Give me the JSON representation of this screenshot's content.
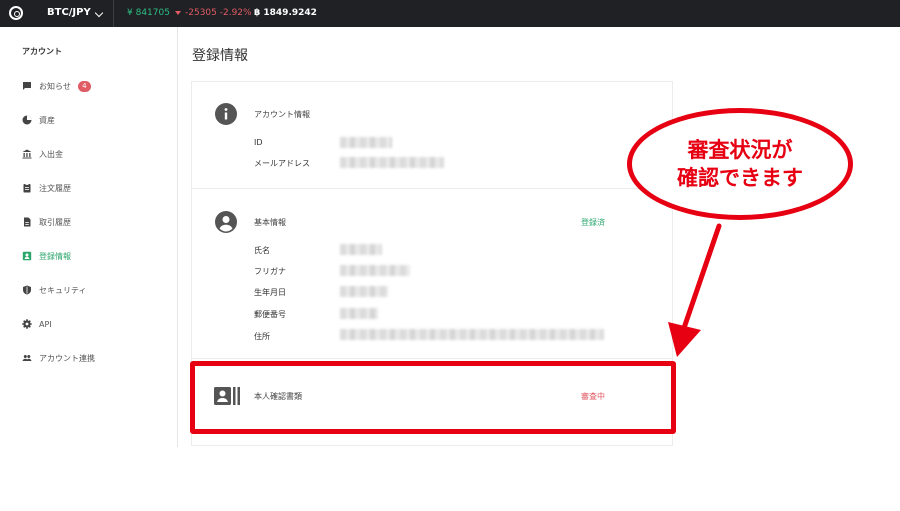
{
  "topbar": {
    "pair": "BTC/JPY",
    "price": "¥ 841705",
    "change": "-25305 -2.92%",
    "volume": "฿ 1849.9242"
  },
  "sidebar": {
    "heading": "アカウント",
    "items": [
      {
        "label": "お知らせ",
        "badge": "4"
      },
      {
        "label": "資産"
      },
      {
        "label": "入出金"
      },
      {
        "label": "注文履歴"
      },
      {
        "label": "取引履歴"
      },
      {
        "label": "登録情報"
      },
      {
        "label": "セキュリティ"
      },
      {
        "label": "API"
      },
      {
        "label": "アカウント連携"
      }
    ],
    "active_index": 5
  },
  "main": {
    "title": "登録情報",
    "account": {
      "title": "アカウント情報",
      "fields": [
        "ID",
        "メールアドレス"
      ]
    },
    "basic": {
      "title": "基本情報",
      "status": "登録済",
      "fields": [
        "氏名",
        "フリガナ",
        "生年月日",
        "郵便番号",
        "住所"
      ]
    },
    "identity": {
      "title": "本人確認書類",
      "status": "審査中"
    }
  },
  "annotation": {
    "line1": "審査状況が",
    "line2": "確認できます"
  },
  "colors": {
    "accent_green": "#2ba66d",
    "alert_red": "#e15b64",
    "annotation_red": "#e60012",
    "topbar_bg": "#1f2124"
  }
}
